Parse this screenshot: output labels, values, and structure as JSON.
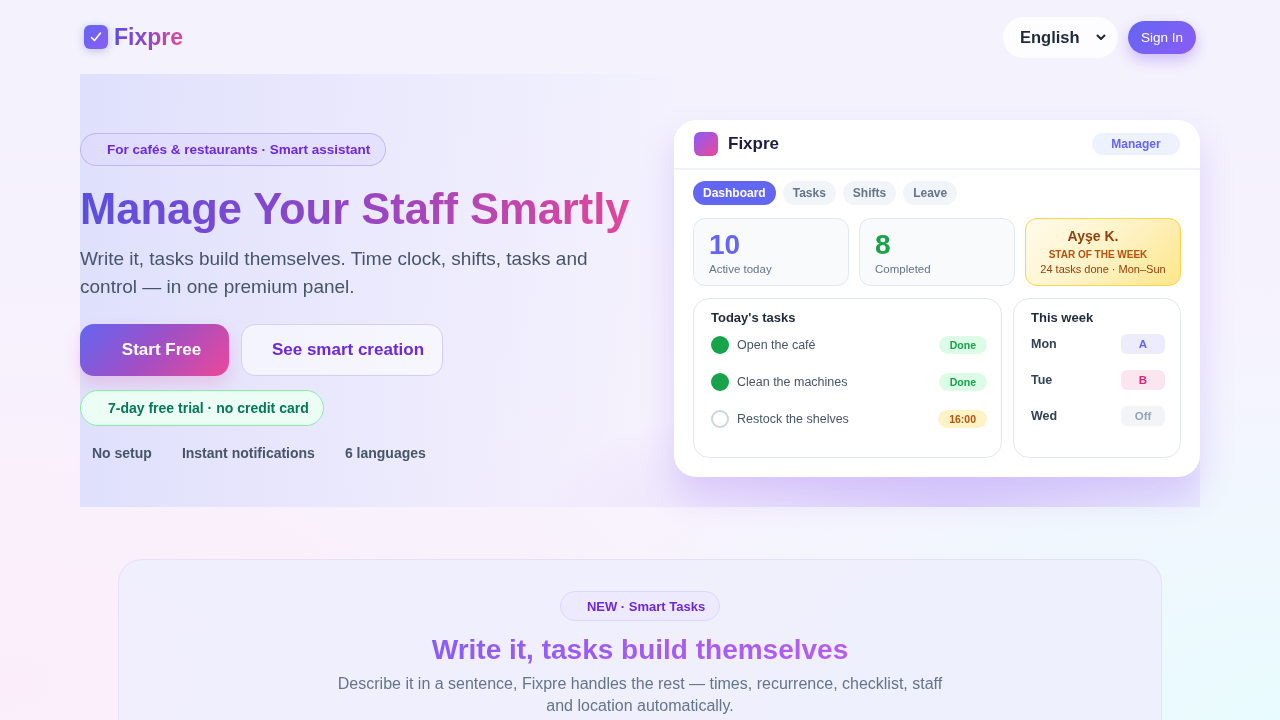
{
  "header": {
    "brand": "Fixpre",
    "language": "English",
    "sign_in": "Sign In"
  },
  "hero": {
    "badge": "For cafés & restaurants · Smart assistant",
    "title": "Manage Your Staff Smartly",
    "subtitle": "Write it, tasks build themselves. Time clock, shifts, tasks and control — in one premium panel.",
    "buttons": [
      {
        "label": "Start Free",
        "kind": "primary"
      },
      {
        "label": "See smart creation",
        "kind": "secondary"
      }
    ],
    "trial": "7-day free trial · no credit card",
    "features": [
      "No setup",
      "Instant notifications",
      "6 languages"
    ]
  },
  "preview": {
    "app_name": "Fixpre",
    "role": "Manager",
    "tabs": [
      {
        "label": "Dashboard",
        "selected": true
      },
      {
        "label": "Tasks",
        "selected": false
      },
      {
        "label": "Shifts",
        "selected": false
      },
      {
        "label": "Leave",
        "selected": false
      }
    ],
    "stats": [
      {
        "kind": "count",
        "value": "10",
        "label": "Active today",
        "color": "#6366f1"
      },
      {
        "kind": "count",
        "value": "8",
        "label": "Completed",
        "color": "#16a34a"
      },
      {
        "kind": "highlight",
        "name": "Ayşe K.",
        "title": "STAR OF THE WEEK",
        "detail": "24 tasks done · Mon–Sun"
      }
    ],
    "tasks": {
      "title": "Today's tasks",
      "items": [
        {
          "label": "Open the café",
          "done": true,
          "status": "Done"
        },
        {
          "label": "Clean the machines",
          "done": true,
          "status": "Done"
        },
        {
          "label": "Restock the shelves",
          "done": false,
          "status": "16:00"
        }
      ]
    },
    "week": {
      "title": "This week",
      "days": [
        {
          "day": "Mon",
          "shift": "A",
          "color": "#6366f1"
        },
        {
          "day": "Tue",
          "shift": "B",
          "color": "#db2777"
        },
        {
          "day": "Wed",
          "shift": "Off",
          "color": "#94a3b8"
        }
      ]
    }
  },
  "feature_section": {
    "badge": "NEW · Smart Tasks",
    "title": "Write it, tasks build themselves",
    "text": "Describe it in a sentence, Fixpre handles the rest — times, recurrence, checklist, staff and location automatically."
  }
}
